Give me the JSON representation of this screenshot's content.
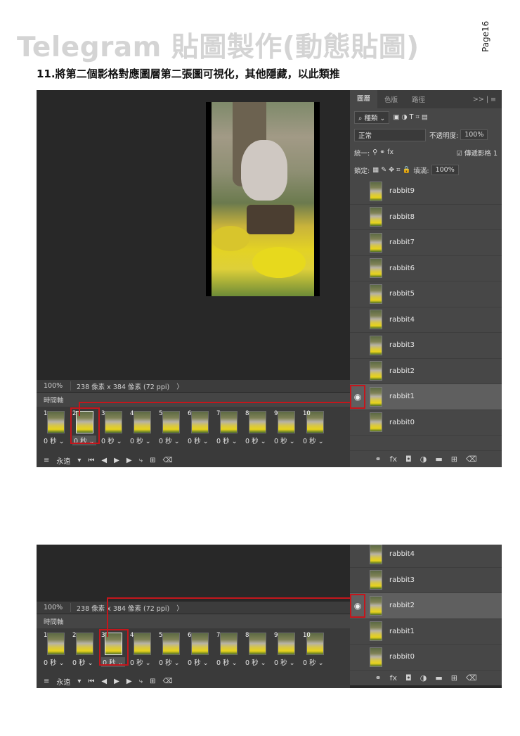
{
  "header": {
    "title": "Telegram 貼圖製作(動態貼圖)",
    "page": "Page16",
    "instruction": "11.將第二個影格對應圖層第二張圖可視化，其他隱藏，以此類推"
  },
  "panel": {
    "tabs": [
      "圖層",
      "色版",
      "路徑"
    ],
    "tab_extra": ">> | ≡",
    "filter_kind": "種類",
    "blend_mode": "正常",
    "opacity_label": "不透明度:",
    "opacity_value": "100%",
    "unify_label": "統一:",
    "propagate_label": "傳遞影格 1",
    "lock_label": "鎖定:",
    "fill_label": "填滿:",
    "fill_value": "100%"
  },
  "icons": {
    "eye": "eye-icon",
    "search": "search-icon",
    "loop_arrow": "chevron-down-icon",
    "first_frame": "first-frame-icon",
    "prev_frame": "prev-frame-icon",
    "play": "play-icon",
    "next_frame": "next-frame-icon",
    "tween": "tween-icon",
    "duplicate": "duplicate-frame-icon",
    "trash": "trash-icon"
  },
  "glyphs": {
    "eye": "◉",
    "first": "⏮",
    "prev": "◀",
    "play": "▶",
    "next": "▶",
    "dup": "⊞",
    "trash": "🗑",
    "menu": "≡"
  },
  "colors": {
    "highlight": "#c4161c",
    "title_gray": "#d4d4d4"
  },
  "screen1": {
    "zoom": "100%",
    "doc_size": "238 像素 x 384 像素 (72 ppi)",
    "doc_arrow": "〉",
    "timeline_label": "時間軸",
    "loop": "永遠",
    "frames": [
      {
        "num": "1",
        "delay": "0 秒"
      },
      {
        "num": "2",
        "delay": "0 秒"
      },
      {
        "num": "3",
        "delay": "0 秒"
      },
      {
        "num": "4",
        "delay": "0 秒"
      },
      {
        "num": "5",
        "delay": "0 秒"
      },
      {
        "num": "6",
        "delay": "0 秒"
      },
      {
        "num": "7",
        "delay": "0 秒"
      },
      {
        "num": "8",
        "delay": "0 秒"
      },
      {
        "num": "9",
        "delay": "0 秒"
      },
      {
        "num": "10",
        "delay": "0 秒"
      }
    ],
    "selected_frame": 2,
    "layers": [
      "rabbit9",
      "rabbit8",
      "rabbit7",
      "rabbit6",
      "rabbit5",
      "rabbit4",
      "rabbit3",
      "rabbit2",
      "rabbit1",
      "rabbit0"
    ],
    "visible_layer": "rabbit1"
  },
  "screen2": {
    "zoom": "100%",
    "doc_size": "238 像素 x 384 像素 (72 ppi)",
    "doc_arrow": "〉",
    "timeline_label": "時間軸",
    "loop": "永遠",
    "frames": [
      {
        "num": "1",
        "delay": "0 秒"
      },
      {
        "num": "2",
        "delay": "0 秒"
      },
      {
        "num": "3",
        "delay": "0 秒"
      },
      {
        "num": "4",
        "delay": "0 秒"
      },
      {
        "num": "5",
        "delay": "0 秒"
      },
      {
        "num": "6",
        "delay": "0 秒"
      },
      {
        "num": "7",
        "delay": "0 秒"
      },
      {
        "num": "8",
        "delay": "0 秒"
      },
      {
        "num": "9",
        "delay": "0 秒"
      },
      {
        "num": "10",
        "delay": "0 秒"
      }
    ],
    "selected_frame": 3,
    "layers": [
      "rabbit4",
      "rabbit3",
      "rabbit2",
      "rabbit1",
      "rabbit0"
    ],
    "visible_layer": "rabbit2"
  }
}
